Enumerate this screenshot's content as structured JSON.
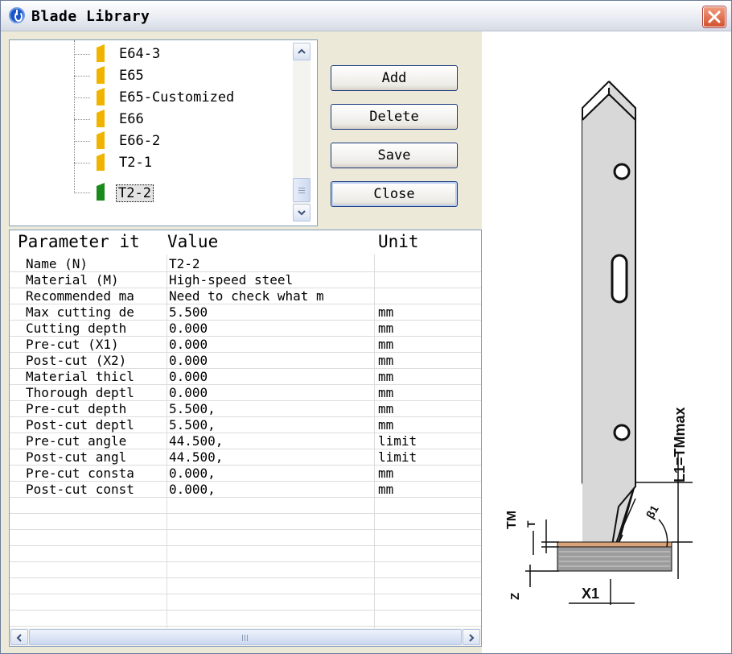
{
  "window": {
    "title": "Blade Library"
  },
  "tree": {
    "items": [
      {
        "label": "E64-3",
        "color": "#f0b400"
      },
      {
        "label": "E65",
        "color": "#f0b400"
      },
      {
        "label": "E65-Customized",
        "color": "#f0b400"
      },
      {
        "label": "E66",
        "color": "#f0b400"
      },
      {
        "label": "E66-2",
        "color": "#f0b400"
      },
      {
        "label": "T2-1",
        "color": "#f0b400"
      },
      {
        "label": "T2-2",
        "color": "#1a8a1a",
        "selected": true
      }
    ]
  },
  "buttons": {
    "add": "Add",
    "delete": "Delete",
    "save": "Save",
    "close": "Close"
  },
  "grid": {
    "headers": [
      "Parameter it",
      "Value",
      "Unit"
    ],
    "rows": [
      [
        "Name (N)",
        "T2-2",
        ""
      ],
      [
        "Material (M)",
        "High-speed steel",
        ""
      ],
      [
        "Recommended ma",
        "Need to check what m",
        ""
      ],
      [
        "Max cutting de",
        "5.500",
        "mm"
      ],
      [
        "Cutting depth",
        "0.000",
        "mm"
      ],
      [
        "Pre-cut (X1)",
        "0.000",
        "mm"
      ],
      [
        "Post-cut (X2)",
        "0.000",
        "mm"
      ],
      [
        "Material thicl",
        "0.000",
        "mm"
      ],
      [
        "Thorough deptl",
        "0.000",
        "mm"
      ],
      [
        "Pre-cut depth",
        "5.500,",
        "mm"
      ],
      [
        "Post-cut deptl",
        "5.500,",
        "mm"
      ],
      [
        "Pre-cut angle",
        "44.500,",
        "limit"
      ],
      [
        "Post-cut angl",
        "44.500,",
        "limit"
      ],
      [
        "Pre-cut consta",
        "0.000,",
        "mm"
      ],
      [
        "Post-cut const",
        "0.000,",
        "mm"
      ]
    ]
  },
  "diagram": {
    "labels": {
      "length": "L1=TMmax",
      "angle": "β1",
      "tm": "TM",
      "t": "T",
      "z": "Z",
      "x1": "X1"
    }
  }
}
